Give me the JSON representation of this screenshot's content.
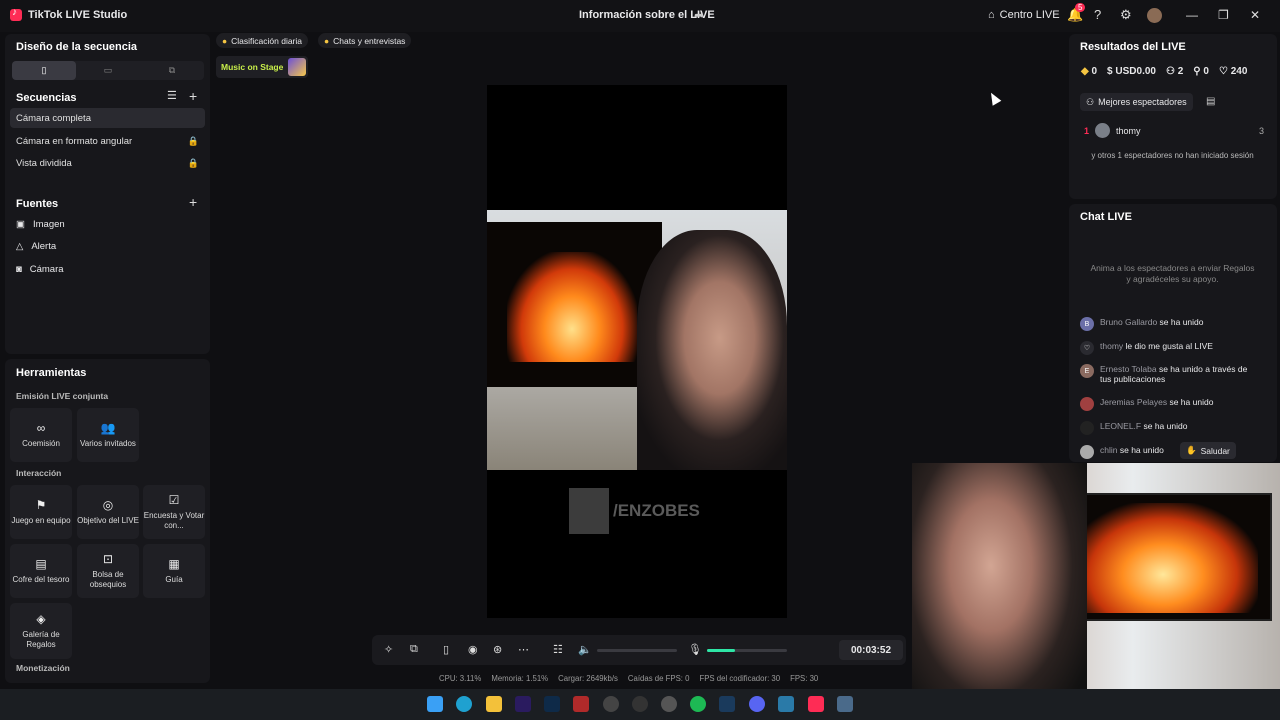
{
  "titlebar": {
    "app_name": "TikTok LIVE Studio",
    "center_title": "Información sobre el LIVE",
    "centro_label": "Centro LIVE",
    "notif_count": "5"
  },
  "left": {
    "layout_title": "Diseño de la secuencia",
    "sequences_title": "Secuencias",
    "sequences": [
      {
        "label": "Cámara completa"
      },
      {
        "label": "Cámara en formato angular"
      },
      {
        "label": "Vista dividida"
      }
    ],
    "sources_title": "Fuentes",
    "sources": [
      {
        "label": "Imagen"
      },
      {
        "label": "Alerta"
      },
      {
        "label": "Cámara"
      }
    ],
    "tools_title": "Herramientas",
    "coemision_title": "Emisión LIVE conjunta",
    "coemision_tools": [
      {
        "label": "Coemisión"
      },
      {
        "label": "Varios invitados"
      }
    ],
    "interaction_title": "Interacción",
    "interaction_tools": [
      {
        "label": "Juego en equipo"
      },
      {
        "label": "Objetivo del LIVE"
      },
      {
        "label": "Encuesta y Votar con..."
      },
      {
        "label": "Cofre del tesoro"
      },
      {
        "label": "Bolsa de obsequios"
      },
      {
        "label": "Guía"
      },
      {
        "label": "Galería de Regalos"
      }
    ],
    "monetization_title": "Monetización"
  },
  "center": {
    "chip1": "Clasificación diaria",
    "chip2": "Chats y entrevistas",
    "music": "Music on Stage",
    "watermark": "/ENZOBES",
    "timer": "00:03:52",
    "volume_level": 0.0,
    "mic_level": 0.35,
    "stats": {
      "cpu": "CPU: 3.11%",
      "mem": "Memoria: 1.51%",
      "load": "Cargar: 2649kb/s",
      "drops": "Caídas de FPS: 0",
      "enc": "FPS del codificador: 30",
      "fps": "FPS: 30"
    }
  },
  "right": {
    "results_title": "Resultados del LIVE",
    "stats": {
      "diamonds": "0",
      "usd": "USD0.00",
      "viewers": "2",
      "followers": "0",
      "likes": "240"
    },
    "best_viewers_label": "Mejores espectadores",
    "top_viewer": {
      "rank": "1",
      "name": "thomy",
      "count": "3"
    },
    "others_text": "y otros 1 espectadores no han iniciado sesión",
    "chat_title": "Chat LIVE",
    "chat_hint": "Anima a los espectadores a enviar Regalos y agradéceles su apoyo.",
    "messages": [
      {
        "initial": "B",
        "name": "Bruno Gallardo",
        "text": "se ha unido"
      },
      {
        "initial": "♡",
        "name": "thomy",
        "text": "le dio me gusta al LIVE"
      },
      {
        "initial": "E",
        "name": "Ernesto Tolaba",
        "text": "se ha unido a través de tus publicaciones"
      },
      {
        "initial": "",
        "name": "Jeremias Pelayes",
        "text": "se ha unido"
      },
      {
        "initial": "",
        "name": "LEONEL.F",
        "text": "se ha unido"
      },
      {
        "initial": "",
        "name": "chlin",
        "text": "se ha unido"
      }
    ],
    "saludar": "Saludar"
  },
  "colors": {
    "accent": "#fe2c55",
    "mic_green": "#2ee6a6",
    "music_yellow": "#c9f04a"
  }
}
